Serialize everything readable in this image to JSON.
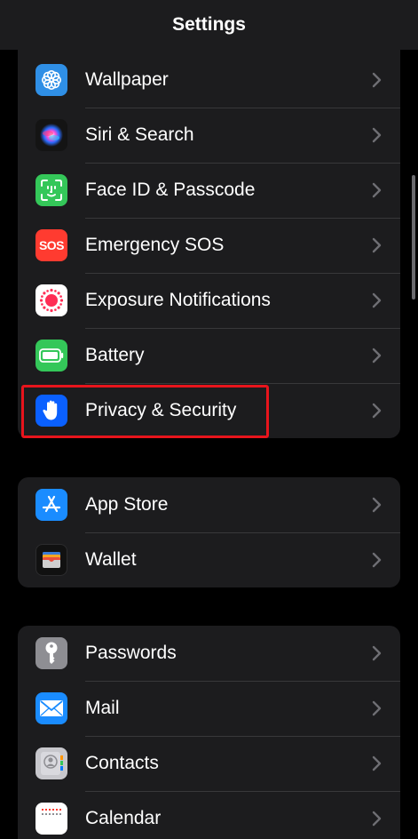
{
  "header": {
    "title": "Settings"
  },
  "groups": [
    {
      "items": [
        {
          "label": "Wallpaper",
          "icon": "wallpaper-icon",
          "color": "#2f8fe6"
        },
        {
          "label": "Siri & Search",
          "icon": "siri-icon",
          "color": "#141414"
        },
        {
          "label": "Face ID & Passcode",
          "icon": "face-id-icon",
          "color": "#34c759"
        },
        {
          "label": "Emergency SOS",
          "icon": "sos-icon",
          "color": "#ff3b30",
          "text": "SOS"
        },
        {
          "label": "Exposure Notifications",
          "icon": "exposure-icon",
          "color": "#ffffff"
        },
        {
          "label": "Battery",
          "icon": "battery-icon",
          "color": "#34c759"
        },
        {
          "label": "Privacy & Security",
          "icon": "hand-icon",
          "color": "#0a60ff"
        }
      ]
    },
    {
      "items": [
        {
          "label": "App Store",
          "icon": "app-store-icon",
          "color": "#1a8cff"
        },
        {
          "label": "Wallet",
          "icon": "wallet-icon",
          "color": "#111111"
        }
      ]
    },
    {
      "items": [
        {
          "label": "Passwords",
          "icon": "key-icon",
          "color": "#8e8e93"
        },
        {
          "label": "Mail",
          "icon": "mail-icon",
          "color": "#1a8cff"
        },
        {
          "label": "Contacts",
          "icon": "contacts-icon",
          "color": "#c7c7cc"
        },
        {
          "label": "Calendar",
          "icon": "calendar-icon",
          "color": "#ffffff"
        }
      ]
    }
  ],
  "highlight": {
    "item": "Privacy & Security",
    "color": "#e8141c"
  }
}
